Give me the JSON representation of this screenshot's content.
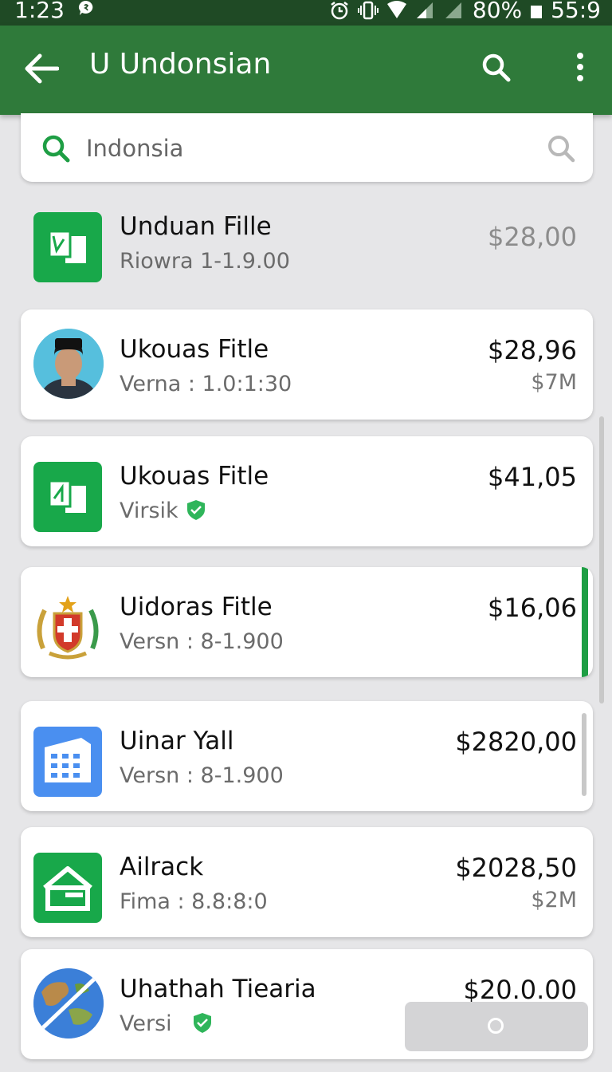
{
  "status_bar": {
    "time": "1:23",
    "battery": "80%",
    "clock": "55:9"
  },
  "app_bar": {
    "title": "U Undonsian"
  },
  "search": {
    "value": "Indonsia"
  },
  "items": [
    {
      "name": "Unduan Fille",
      "sub": "Riowra 1-1.9.00",
      "price": "$28,00",
      "price_secondary": "",
      "icon": "document-icon"
    },
    {
      "name": "Ukouas Fitle",
      "sub": "Verna : 1.0:1:30",
      "price": "$28,96",
      "price_secondary": "$7M",
      "icon": "avatar-photo"
    },
    {
      "name": "Ukouas Fitle",
      "sub": "Virsik",
      "price": "$41,05",
      "price_secondary": "",
      "icon": "document-icon",
      "verified": true
    },
    {
      "name": "Uidoras Fitle",
      "sub": "Versn : 8-1.900",
      "price": "$16,06",
      "price_secondary": "",
      "icon": "emblem-icon"
    },
    {
      "name": "Uinar Yall",
      "sub": "Versn : 8-1.900",
      "price": "$2820,00",
      "price_secondary": "",
      "icon": "building-icon"
    },
    {
      "name": "Ailrack",
      "sub": "Fima : 8.8:8:0",
      "price": "$2028,50",
      "price_secondary": "$2M",
      "icon": "home-icon"
    },
    {
      "name": "Uhathah Tiearia",
      "sub": "Versi",
      "price": "$20.0.00",
      "price_secondary": "",
      "icon": "globe-icon",
      "verified": true
    }
  ],
  "colors": {
    "app_bar": "#2f7a3a",
    "status_bar": "#1f4a25",
    "accent": "#1e9e44",
    "blue_icon": "#4a8ff0"
  }
}
